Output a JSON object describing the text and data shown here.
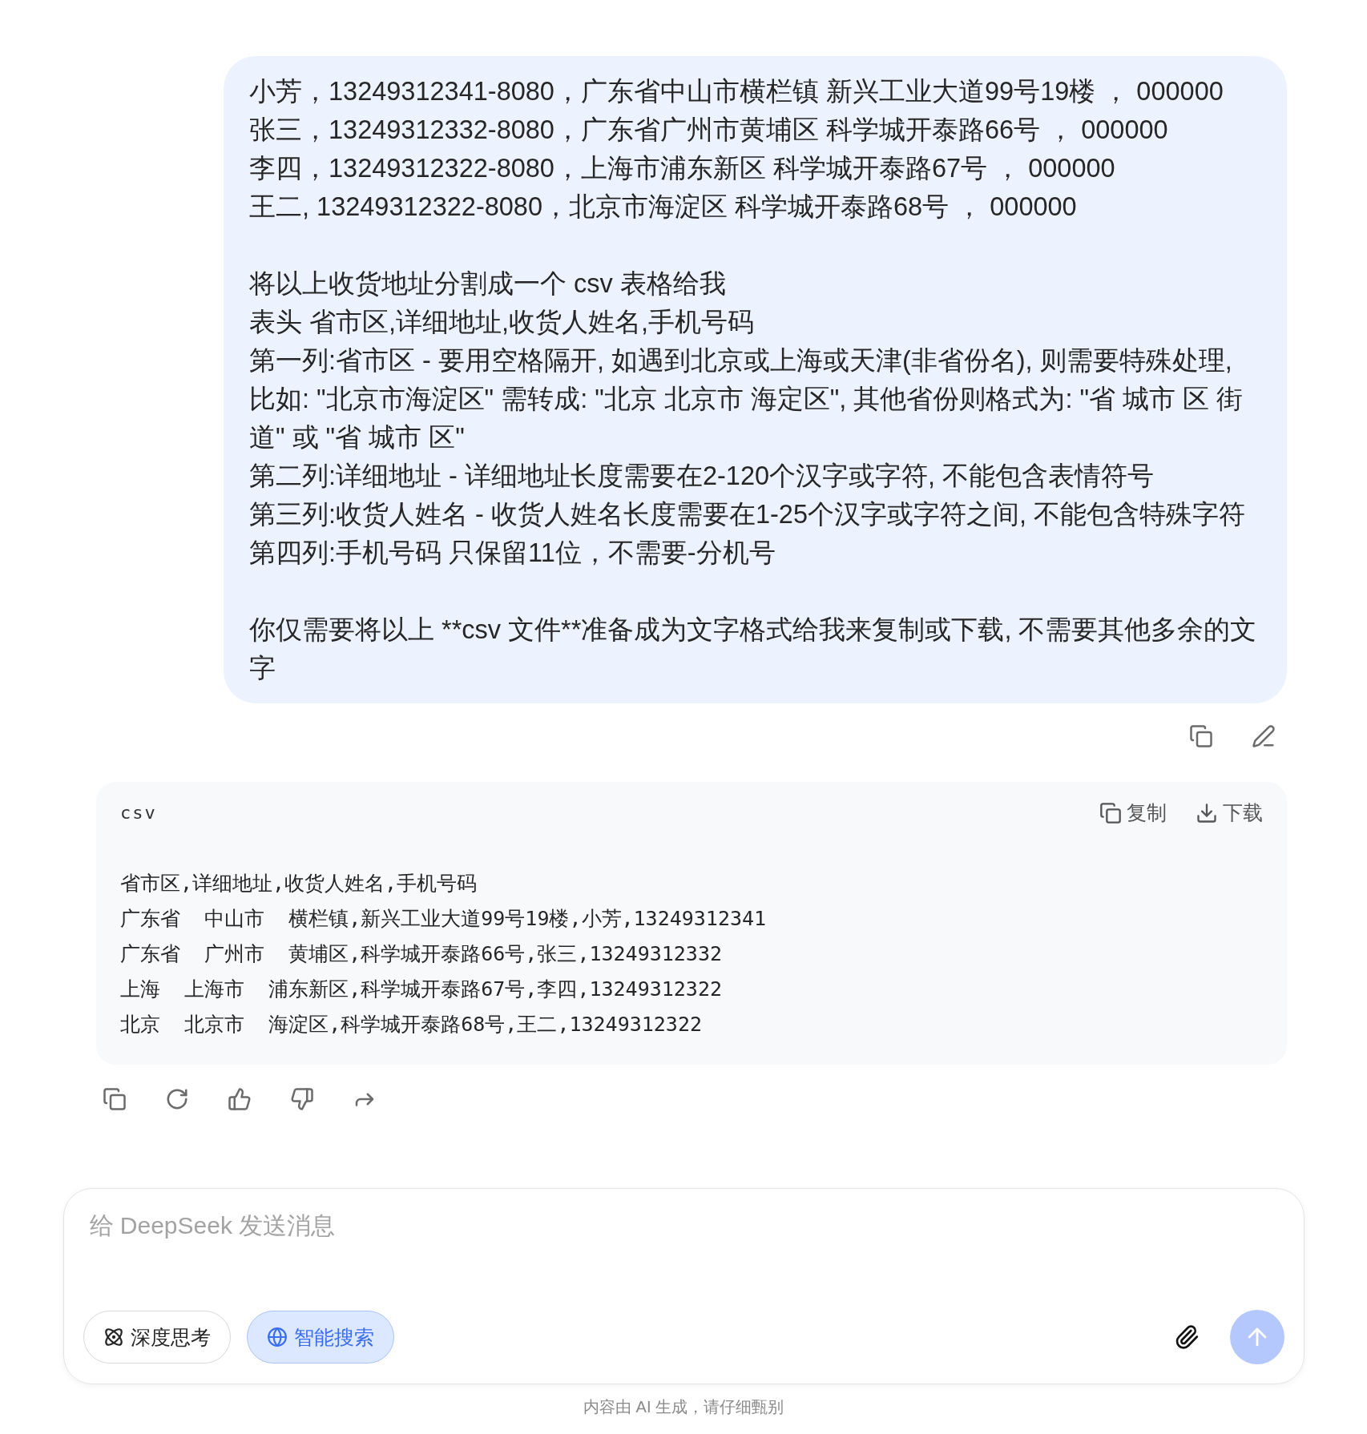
{
  "user_message": {
    "paragraphs": [
      [
        "小芳，13249312341-8080，广东省中山市横栏镇 新兴工业大道99号19楼 ， 000000",
        "张三，13249312332-8080，广东省广州市黄埔区 科学城开泰路66号 ， 000000",
        "李四，13249312322-8080，上海市浦东新区 科学城开泰路67号 ， 000000",
        "王二, 13249312322-8080，北京市海淀区 科学城开泰路68号 ， 000000"
      ],
      [
        "将以上收货地址分割成一个 csv 表格给我",
        "表头 省市区,详细地址,收货人姓名,手机号码",
        "第一列:省市区 - 要用空格隔开, 如遇到北京或上海或天津(非省份名), 则需要特殊处理, 比如: \"北京市海淀区\" 需转成: \"北京 北京市 海定区\", 其他省份则格式为: \"省 城市 区 街道\" 或 \"省 城市 区\"",
        "第二列:详细地址 - 详细地址长度需要在2-120个汉字或字符, 不能包含表情符号",
        "第三列:收货人姓名 - 收货人姓名长度需要在1-25个汉字或字符之间, 不能包含特殊字符",
        "第四列:手机号码 只保留11位，不需要-分机号"
      ],
      [
        "你仅需要将以上 **csv 文件**准备成为文字格式给我来复制或下载, 不需要其他多余的文字"
      ]
    ]
  },
  "code_block": {
    "language": "csv",
    "actions": [
      {
        "kind": "copy",
        "label": "复制"
      },
      {
        "kind": "download",
        "label": "下载"
      }
    ],
    "lines": [
      "省市区,详细地址,收货人姓名,手机号码",
      "广东省  中山市  横栏镇,新兴工业大道99号19楼,小芳,13249312341",
      "广东省  广州市  黄埔区,科学城开泰路66号,张三,13249312332",
      "上海  上海市  浦东新区,科学城开泰路67号,李四,13249312322",
      "北京  北京市  海淀区,科学城开泰路68号,王二,13249312322"
    ]
  },
  "composer": {
    "placeholder": "给 DeepSeek 发送消息",
    "toggles": [
      {
        "kind": "think",
        "label": "深度思考",
        "selected": false
      },
      {
        "kind": "search",
        "label": "智能搜索",
        "selected": true
      }
    ],
    "send_disabled": true
  },
  "footer": "内容由 AI 生成，请仔细甄别"
}
